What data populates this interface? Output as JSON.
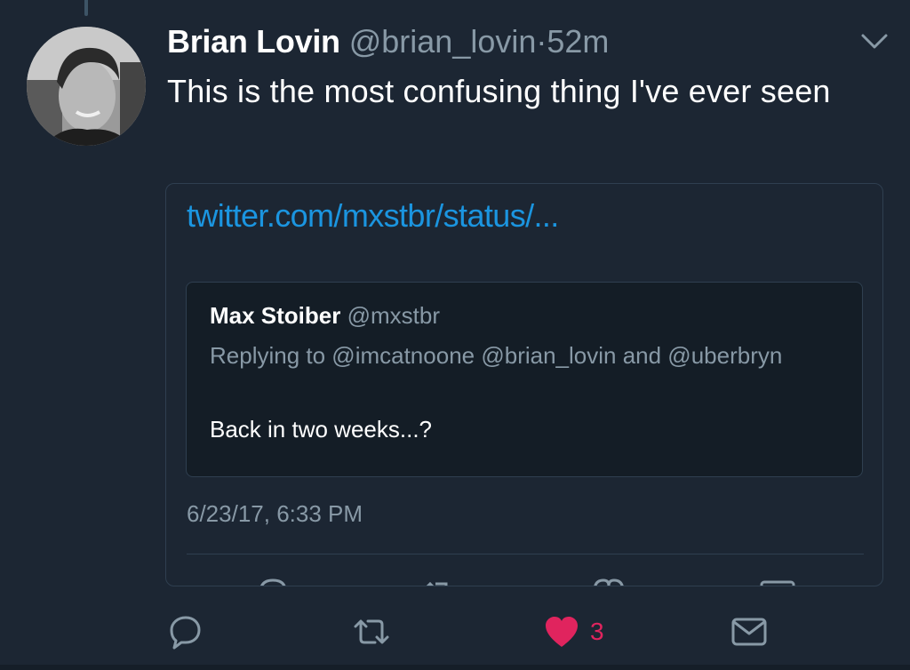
{
  "tweet": {
    "author_name": "Brian Lovin",
    "author_handle": "@brian_lovin",
    "separator": "·",
    "time": "52m",
    "text": "This is the most confusing thing I've ever seen",
    "icons": {
      "avatar": "avatar",
      "menu": "chevron-down-icon"
    }
  },
  "card": {
    "link_text": "twitter.com/mxstbr/status/...",
    "quoted_tweet": {
      "name": "Max Stoiber",
      "handle": "@mxstbr",
      "replying_to": "Replying to @imcatnoone @brian_lovin and @uberbryn",
      "text": "Back in two weeks...?"
    },
    "timestamp": "6/23/17, 6:33 PM",
    "action_icons": [
      "reply-icon",
      "retweet-icon",
      "like-icon",
      "dm-icon"
    ]
  },
  "actions": {
    "reply_icon": "reply-icon",
    "retweet_icon": "retweet-icon",
    "like_icon": "heart-icon",
    "like_count": "3",
    "dm_icon": "envelope-icon"
  },
  "colors": {
    "background": "#1c2633",
    "text_primary": "#ffffff",
    "text_secondary": "#8899a6",
    "link": "#1b95e0",
    "like": "#e0245e",
    "border": "#2f3f50"
  }
}
